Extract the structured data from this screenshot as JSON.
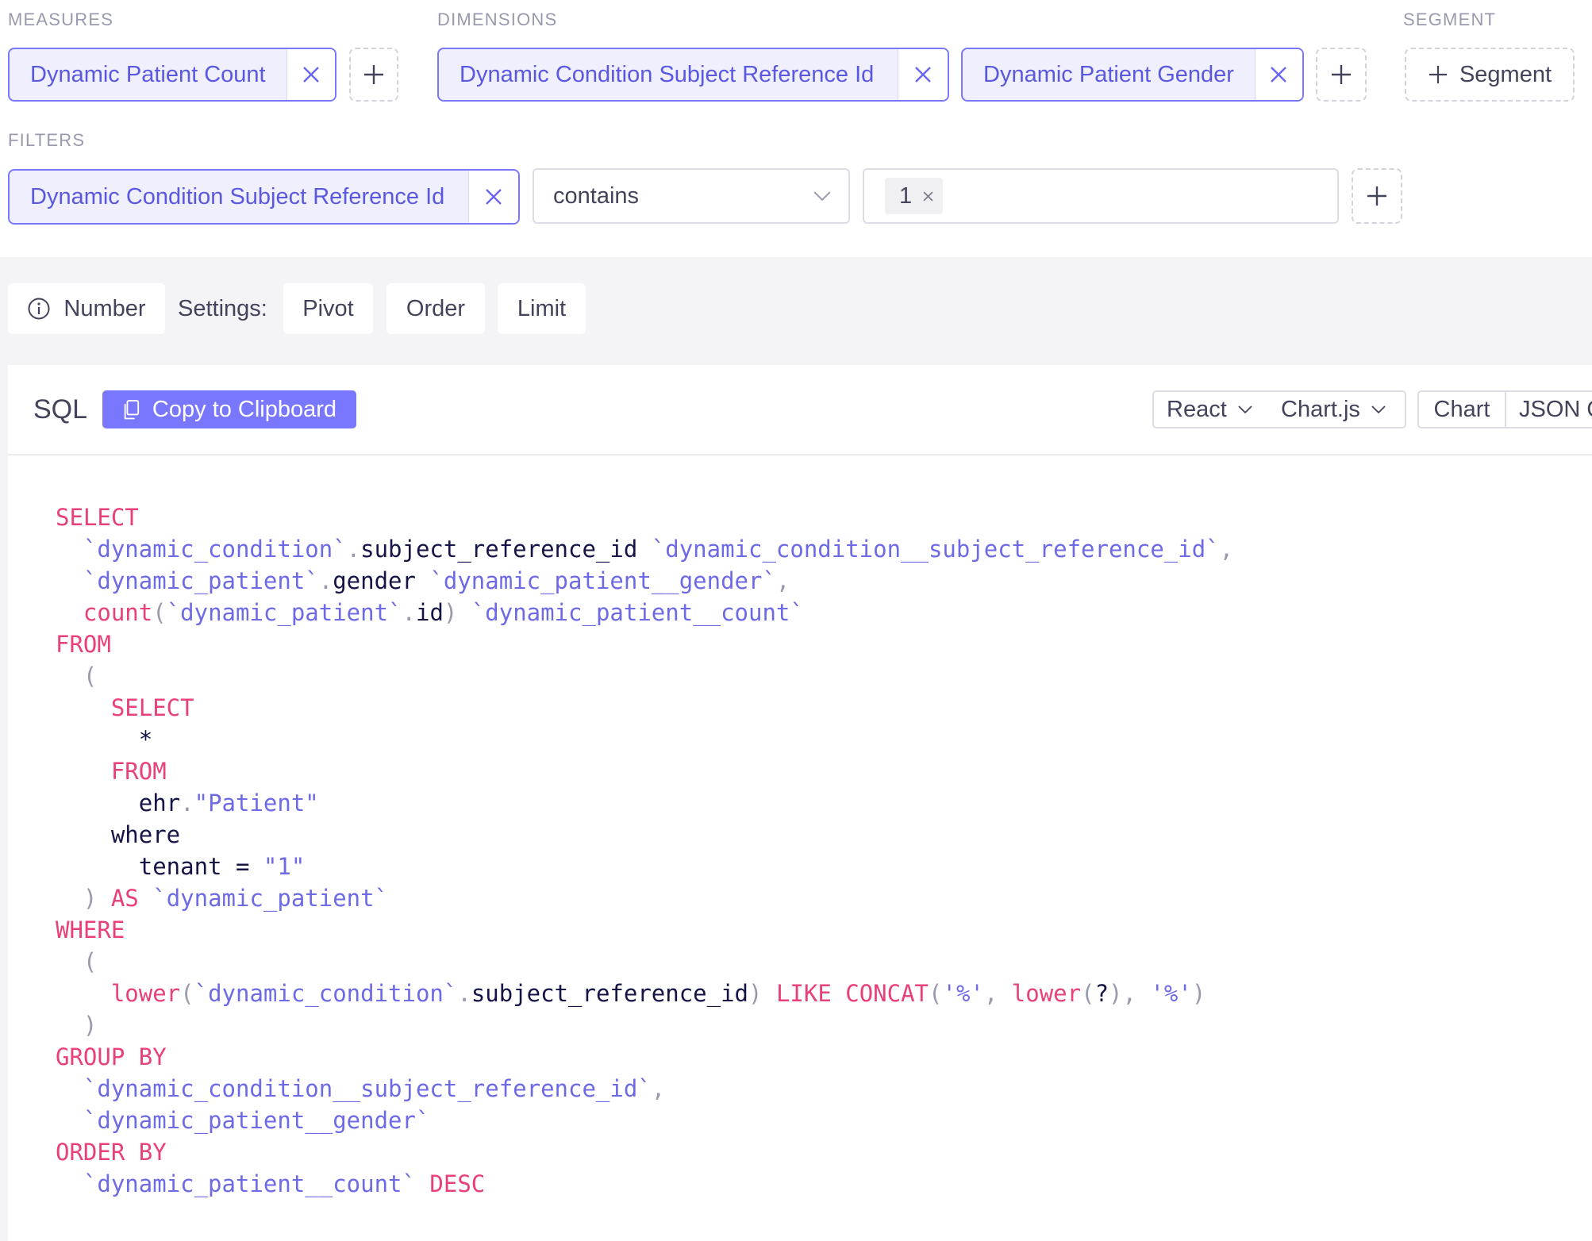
{
  "query_builder": {
    "measures": {
      "label": "MEASURES",
      "items": [
        {
          "label": "Dynamic Patient Count"
        }
      ]
    },
    "dimensions": {
      "label": "DIMENSIONS",
      "items": [
        {
          "label": "Dynamic Condition Subject Reference Id"
        },
        {
          "label": "Dynamic Patient Gender"
        }
      ]
    },
    "segment": {
      "label": "SEGMENT",
      "add_label": "Segment"
    },
    "filters": {
      "label": "FILTERS",
      "member": "Dynamic Condition Subject Reference Id",
      "operator": "contains",
      "values": [
        "1"
      ]
    }
  },
  "toolbar": {
    "chart_type": "Number",
    "settings_label": "Settings:",
    "buttons": [
      "Pivot",
      "Order",
      "Limit"
    ]
  },
  "sql_panel": {
    "title": "SQL",
    "copy_label": "Copy to Clipboard",
    "framework": "React",
    "library": "Chart.js",
    "tabs": [
      "Chart",
      "JSON Q"
    ]
  },
  "sql_code": [
    [
      [
        "k",
        "SELECT"
      ]
    ],
    [
      [
        "i",
        "  "
      ],
      [
        "s",
        "`dynamic_condition`"
      ],
      [
        "p",
        "."
      ],
      [
        "i",
        "subject_reference_id "
      ],
      [
        "s",
        "`dynamic_condition__subject_reference_id`"
      ],
      [
        "p",
        ","
      ]
    ],
    [
      [
        "i",
        "  "
      ],
      [
        "s",
        "`dynamic_patient`"
      ],
      [
        "p",
        "."
      ],
      [
        "i",
        "gender "
      ],
      [
        "s",
        "`dynamic_patient__gender`"
      ],
      [
        "p",
        ","
      ]
    ],
    [
      [
        "i",
        "  "
      ],
      [
        "k",
        "count"
      ],
      [
        "p",
        "("
      ],
      [
        "s",
        "`dynamic_patient`"
      ],
      [
        "p",
        "."
      ],
      [
        "i",
        "id"
      ],
      [
        "p",
        ") "
      ],
      [
        "s",
        "`dynamic_patient__count`"
      ]
    ],
    [
      [
        "k",
        "FROM"
      ]
    ],
    [
      [
        "i",
        "  "
      ],
      [
        "p",
        "("
      ]
    ],
    [
      [
        "i",
        "    "
      ],
      [
        "k",
        "SELECT"
      ]
    ],
    [
      [
        "i",
        "      *"
      ]
    ],
    [
      [
        "i",
        "    "
      ],
      [
        "k",
        "FROM"
      ]
    ],
    [
      [
        "i",
        "      ehr"
      ],
      [
        "p",
        "."
      ],
      [
        "s",
        "\"Patient\""
      ]
    ],
    [
      [
        "i",
        "    where"
      ]
    ],
    [
      [
        "i",
        "      tenant = "
      ],
      [
        "s",
        "\"1\""
      ]
    ],
    [
      [
        "i",
        "  "
      ],
      [
        "p",
        ") "
      ],
      [
        "k",
        "AS "
      ],
      [
        "s",
        "`dynamic_patient`"
      ]
    ],
    [
      [
        "k",
        "WHERE"
      ]
    ],
    [
      [
        "i",
        "  "
      ],
      [
        "p",
        "("
      ]
    ],
    [
      [
        "i",
        "    "
      ],
      [
        "k",
        "lower"
      ],
      [
        "p",
        "("
      ],
      [
        "s",
        "`dynamic_condition`"
      ],
      [
        "p",
        "."
      ],
      [
        "i",
        "subject_reference_id"
      ],
      [
        "p",
        ") "
      ],
      [
        "k",
        "LIKE CONCAT"
      ],
      [
        "p",
        "("
      ],
      [
        "s",
        "'%'"
      ],
      [
        "p",
        ", "
      ],
      [
        "k",
        "lower"
      ],
      [
        "p",
        "("
      ],
      [
        "i",
        "?"
      ],
      [
        "p",
        "), "
      ],
      [
        "s",
        "'%'"
      ],
      [
        "p",
        ")"
      ]
    ],
    [
      [
        "i",
        "  "
      ],
      [
        "p",
        ")"
      ]
    ],
    [
      [
        "k",
        "GROUP BY"
      ]
    ],
    [
      [
        "i",
        "  "
      ],
      [
        "s",
        "`dynamic_condition__subject_reference_id`"
      ],
      [
        "p",
        ","
      ]
    ],
    [
      [
        "i",
        "  "
      ],
      [
        "s",
        "`dynamic_patient__gender`"
      ]
    ],
    [
      [
        "k",
        "ORDER BY"
      ]
    ],
    [
      [
        "i",
        "  "
      ],
      [
        "s",
        "`dynamic_patient__count`"
      ],
      [
        "i",
        " "
      ],
      [
        "k",
        "DESC"
      ]
    ]
  ]
}
